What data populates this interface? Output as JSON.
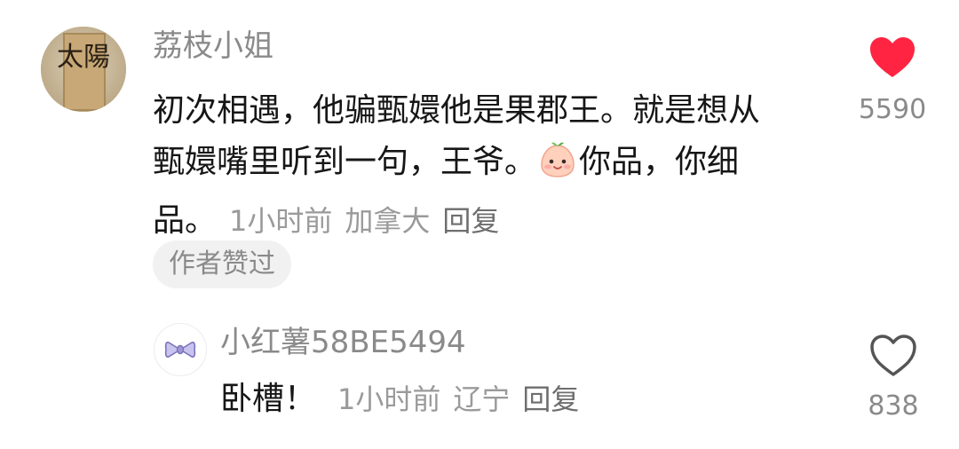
{
  "comment": {
    "username": "荔枝小姐",
    "avatar_label": "太陽",
    "text": "初次相遇，他骗甄嬛他是果郡王。就是想从甄嬛嘴里听到一句，王爷。",
    "text_tail": "你品，你细品。",
    "emoji_icon": "peach-face-icon",
    "time": "1小时前",
    "location": "加拿大",
    "reply_label": "回复",
    "author_liked": "作者赞过",
    "like_count": "5590",
    "liked": true
  },
  "reply": {
    "username": "小红薯58BE5494",
    "avatar_icon": "bow-icon",
    "text": "卧槽！",
    "time": "1小时前",
    "location": "辽宁",
    "reply_label": "回复",
    "like_count": "838",
    "liked": false
  },
  "colors": {
    "like_active": "#ff2442",
    "like_inactive": "#555555",
    "meta": "#9a9a9a"
  }
}
